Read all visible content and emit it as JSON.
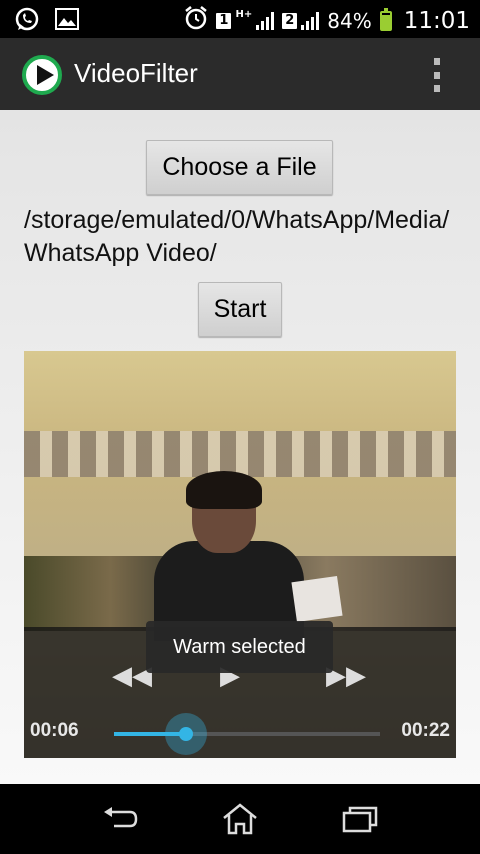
{
  "status_bar": {
    "notification_icons": [
      "whatsapp-icon",
      "gallery-icon"
    ],
    "status_icons": [
      "alarm-icon",
      "sim1-signal-icon",
      "sim2-signal-icon",
      "battery-icon"
    ],
    "sim1_label": "1",
    "sim1_network": "H+",
    "sim2_label": "2",
    "battery_percent": "84%",
    "battery_level": 0.84,
    "battery_color": "#9acd32",
    "time": "11:01"
  },
  "action_bar": {
    "title": "VideoFilter",
    "icon": "play-logo-icon",
    "overflow_icon": "more-vert-icon",
    "background": "#2b2b2b"
  },
  "main": {
    "choose_button_label": "Choose a File",
    "selected_path": "/storage/emulated/0/WhatsApp/Media/WhatsApp Video/",
    "start_button_label": "Start"
  },
  "video_player": {
    "controls": [
      "rewind-icon",
      "play-icon",
      "fast-forward-icon"
    ],
    "current_time": "00:06",
    "duration": "00:22",
    "progress_fraction": 0.27,
    "accent_color": "#33b5e5"
  },
  "toast": {
    "message": "Warm selected"
  },
  "nav_bar": {
    "buttons": [
      "back-icon",
      "home-icon",
      "recent-apps-icon"
    ]
  }
}
